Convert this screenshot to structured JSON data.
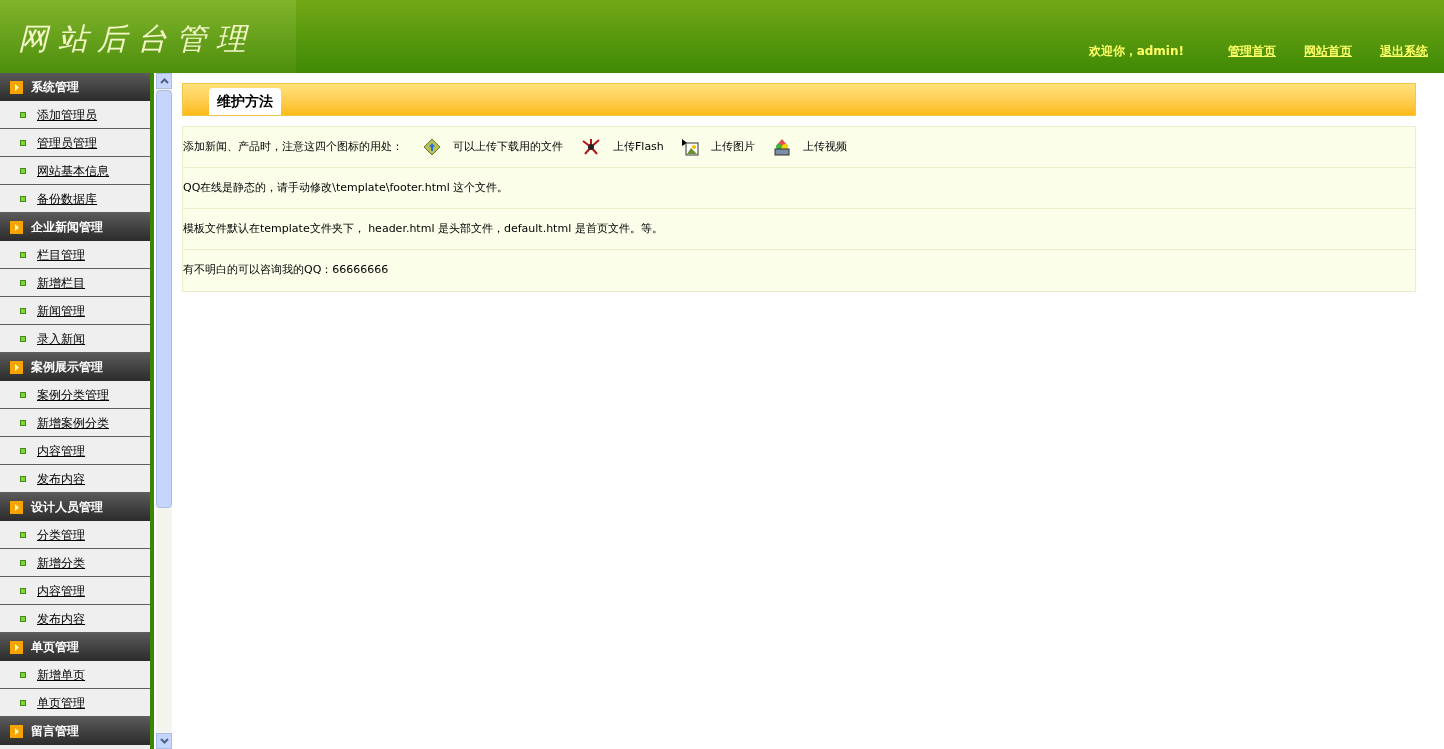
{
  "header": {
    "logo": "网 站 后 台 管 理",
    "welcome": "欢迎你，admin!",
    "links": [
      "管理首页",
      "网站首页",
      "退出系统"
    ]
  },
  "sidebar": {
    "groups": [
      {
        "title": "系统管理",
        "items": [
          "添加管理员",
          "管理员管理",
          "网站基本信息",
          "备份数据库"
        ]
      },
      {
        "title": "企业新闻管理",
        "items": [
          "栏目管理",
          "新增栏目",
          "新闻管理",
          "录入新闻"
        ]
      },
      {
        "title": "案例展示管理",
        "items": [
          "案例分类管理",
          "新增案例分类",
          "内容管理",
          "发布内容"
        ]
      },
      {
        "title": "设计人员管理",
        "items": [
          "分类管理",
          "新增分类",
          "内容管理",
          "发布内容"
        ]
      },
      {
        "title": "单页管理",
        "items": [
          "新增单页",
          "单页管理"
        ]
      },
      {
        "title": "留言管理"
      }
    ]
  },
  "panel": {
    "tab": "维护方法",
    "rows": [
      {
        "kind": "icons",
        "text": "添加新闻、产品时，注意这四个图标的用处：",
        "icons": [
          {
            "kind": "file",
            "label": "可以上传下载用的文件"
          },
          {
            "kind": "flash",
            "label": "上传Flash"
          },
          {
            "kind": "image",
            "label": "上传图片"
          },
          {
            "kind": "video",
            "label": "上传视频"
          }
        ]
      },
      {
        "kind": "text",
        "text": "QQ在线是静态的，请手动修改\\template\\footer.html 这个文件。"
      },
      {
        "kind": "text",
        "text": "模板文件默认在template文件夹下， header.html 是头部文件，default.html 是首页文件。等。"
      },
      {
        "kind": "text",
        "text": "有不明白的可以咨询我的QQ：66666666"
      }
    ]
  }
}
